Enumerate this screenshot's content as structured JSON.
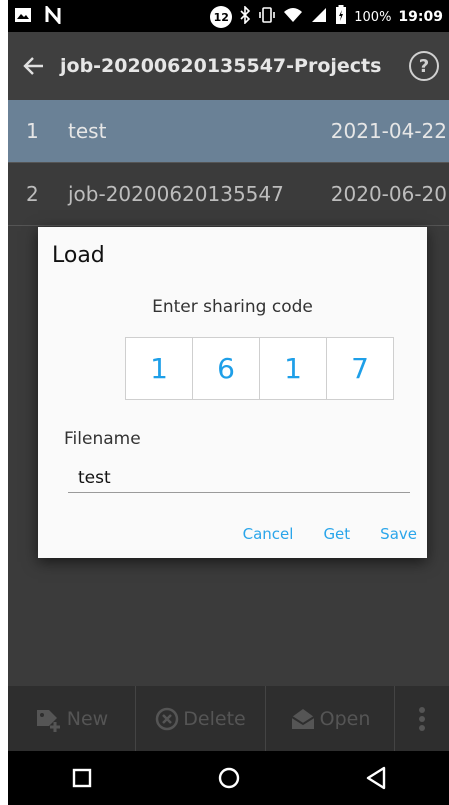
{
  "status_bar": {
    "notification_count": "12",
    "battery_percent": "100%",
    "time": "19:09",
    "icons": [
      "image-icon",
      "n-icon",
      "bluetooth-icon",
      "vibrate-icon",
      "wifi-icon",
      "signal-icon",
      "battery-icon"
    ]
  },
  "app_bar": {
    "title": "job-20200620135547-Projects",
    "icons": [
      "back-arrow-icon",
      "help-icon"
    ],
    "help_glyph": "?"
  },
  "list": {
    "rows": [
      {
        "num": "1",
        "name": "test",
        "date": "2021-04-22",
        "selected": true
      },
      {
        "num": "2",
        "name": "job-20200620135547",
        "date": "2020-06-20",
        "selected": false
      }
    ]
  },
  "dialog": {
    "title": "Load",
    "prompt": "Enter sharing code",
    "code_digits": [
      "1",
      "6",
      "1",
      "7"
    ],
    "filename_label": "Filename",
    "filename_value": "test",
    "actions": {
      "cancel": "Cancel",
      "get": "Get",
      "save": "Save"
    },
    "accent_color": "#2aa5ea"
  },
  "action_bar": {
    "new_label": "New",
    "delete_label": "Delete",
    "open_label": "Open",
    "icons": [
      "add-tag-icon",
      "delete-circle-icon",
      "open-mail-icon",
      "more-vert-icon"
    ]
  },
  "nav_bar": {
    "icons": [
      "recents-square-icon",
      "home-circle-icon",
      "back-triangle-icon"
    ]
  }
}
